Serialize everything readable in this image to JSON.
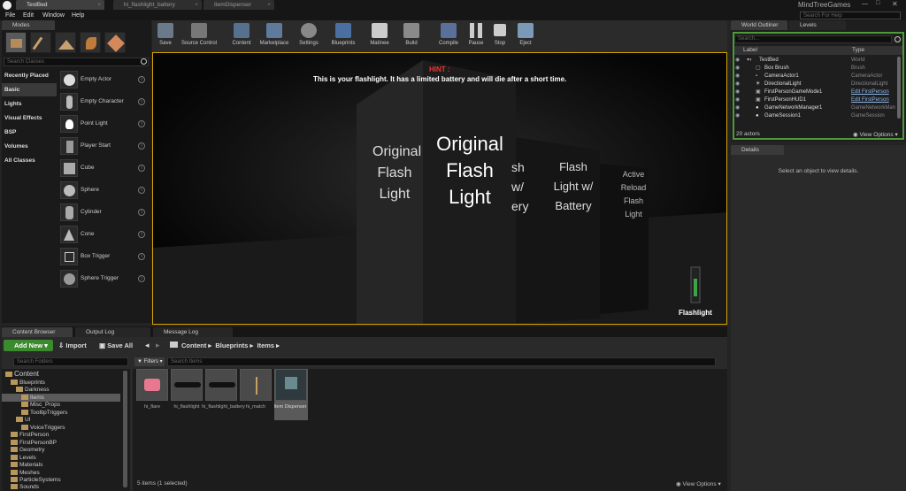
{
  "tabs": [
    {
      "label": "TestBed"
    },
    {
      "label": "hi_flashlight_battery"
    },
    {
      "label": "ItemDispenser"
    }
  ],
  "project_name": "MindTreeGames",
  "menu": [
    "File",
    "Edit",
    "Window",
    "Help"
  ],
  "help_search_placeholder": "Search For Help",
  "modes": {
    "tab": "Modes",
    "search_placeholder": "Search Classes",
    "categories": [
      "Recently Placed",
      "Basic",
      "Lights",
      "Visual Effects",
      "BSP",
      "Volumes",
      "All Classes"
    ],
    "items": [
      "Empty Actor",
      "Empty Character",
      "Point Light",
      "Player Start",
      "Cube",
      "Sphere",
      "Cylinder",
      "Cone",
      "Box Trigger",
      "Sphere Trigger"
    ]
  },
  "toolbar": [
    "Save",
    "Source Control",
    "Content",
    "Marketplace",
    "Settings",
    "Blueprints",
    "Matinee",
    "Build",
    "Compile",
    "Pause",
    "Stop",
    "Eject"
  ],
  "viewport": {
    "hint_title": "HINT :",
    "hint_text": "This is your flashlight. It has a limited battery and will die after a short time.",
    "sign_main": [
      "Original",
      "Flash",
      "Light"
    ],
    "sign_left": [
      "Original",
      "Flash",
      "Light"
    ],
    "sign_mid": [
      "sh",
      "w/",
      "ery"
    ],
    "sign_right": [
      "Flash",
      "Light w/",
      "Battery"
    ],
    "sign_far": [
      "Active",
      "Reload",
      "Flash",
      "Light"
    ],
    "item_label": "Flashlight"
  },
  "bottom_tabs": [
    "Content Browser",
    "Output Log",
    "Message Log"
  ],
  "content_browser": {
    "add_new": "Add New",
    "import": "Import",
    "save_all": "Save All",
    "path": [
      "Content",
      "Blueprints",
      "Items"
    ],
    "folder_search": "Search Folders",
    "filters": "Filters",
    "asset_search": "Search Items",
    "folders": [
      {
        "name": "Content",
        "depth": 0
      },
      {
        "name": "Blueprints",
        "depth": 1
      },
      {
        "name": "Darkness",
        "depth": 2
      },
      {
        "name": "Items",
        "depth": 3
      },
      {
        "name": "Misc_Props",
        "depth": 3
      },
      {
        "name": "TooltipTriggers",
        "depth": 3
      },
      {
        "name": "UI",
        "depth": 2
      },
      {
        "name": "VoiceTriggers",
        "depth": 3
      },
      {
        "name": "FirstPerson",
        "depth": 1
      },
      {
        "name": "FirstPersonBP",
        "depth": 1
      },
      {
        "name": "Geometry",
        "depth": 1
      },
      {
        "name": "Levels",
        "depth": 1
      },
      {
        "name": "Materials",
        "depth": 1
      },
      {
        "name": "Meshes",
        "depth": 1
      },
      {
        "name": "ParticleSystems",
        "depth": 1
      },
      {
        "name": "Sounds",
        "depth": 1
      }
    ],
    "assets": [
      "hi_flare",
      "hi_flashlight",
      "hi_flashlight_battery",
      "hi_match",
      "Item Dispenser"
    ],
    "status": "5 items (1 selected)",
    "view_options": "View Options"
  },
  "outliner": {
    "tabs": [
      "World Outliner",
      "Levels"
    ],
    "search_placeholder": "Search...",
    "col_label": "Label",
    "col_type": "Type",
    "rows": [
      {
        "label": "TestBed",
        "type": "World"
      },
      {
        "label": "Box Brush",
        "type": "Brush"
      },
      {
        "label": "CameraActor1",
        "type": "CameraActor"
      },
      {
        "label": "DirectionalLight",
        "type": "DirectionalLight"
      },
      {
        "label": "FirstPersonGameMode1",
        "type": "Edit FirstPerson"
      },
      {
        "label": "FirstPersonHUD1",
        "type": "Edit FirstPerson"
      },
      {
        "label": "GameNetworkManager1",
        "type": "GameNetworkMan"
      },
      {
        "label": "GameSession1",
        "type": "GameSession"
      }
    ],
    "count": "20 actors",
    "view_options": "View Options"
  },
  "details": {
    "tab": "Details",
    "empty": "Select an object to view details."
  }
}
